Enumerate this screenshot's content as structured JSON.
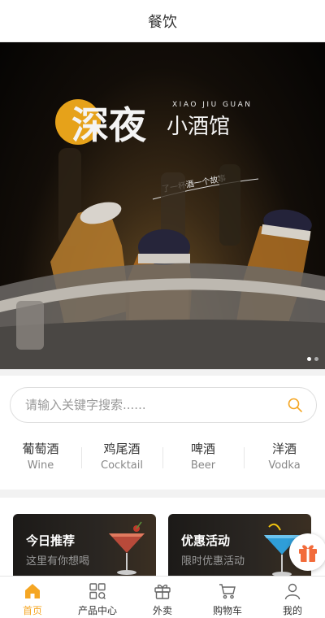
{
  "header": {
    "title": "餐饮"
  },
  "banner": {
    "headline": "深夜",
    "subhead": "小酒馆",
    "pinyin": "XIAO JIU GUAN",
    "tagline": "了一杯酒一个故事",
    "slides": 2,
    "active_slide": 1
  },
  "search": {
    "placeholder": "请输入关键字搜索......"
  },
  "categories": [
    {
      "zh": "葡萄酒",
      "en": "Wine"
    },
    {
      "zh": "鸡尾酒",
      "en": "Cocktail"
    },
    {
      "zh": "啤酒",
      "en": "Beer"
    },
    {
      "zh": "洋酒",
      "en": "Vodka"
    }
  ],
  "promos": [
    {
      "title": "今日推荐",
      "subtitle": "这里有你想喝"
    },
    {
      "title": "优惠活动",
      "subtitle": "限时优惠活动"
    }
  ],
  "tabbar": {
    "items": [
      {
        "label": "首页",
        "icon": "home-icon",
        "active": true
      },
      {
        "label": "产品中心",
        "icon": "grid-icon",
        "active": false
      },
      {
        "label": "外卖",
        "icon": "gift-box-icon",
        "active": false
      },
      {
        "label": "购物车",
        "icon": "cart-icon",
        "active": false
      },
      {
        "label": "我的",
        "icon": "user-icon",
        "active": false
      }
    ]
  },
  "colors": {
    "accent": "#f5a623",
    "gift": "#f26b3a"
  }
}
